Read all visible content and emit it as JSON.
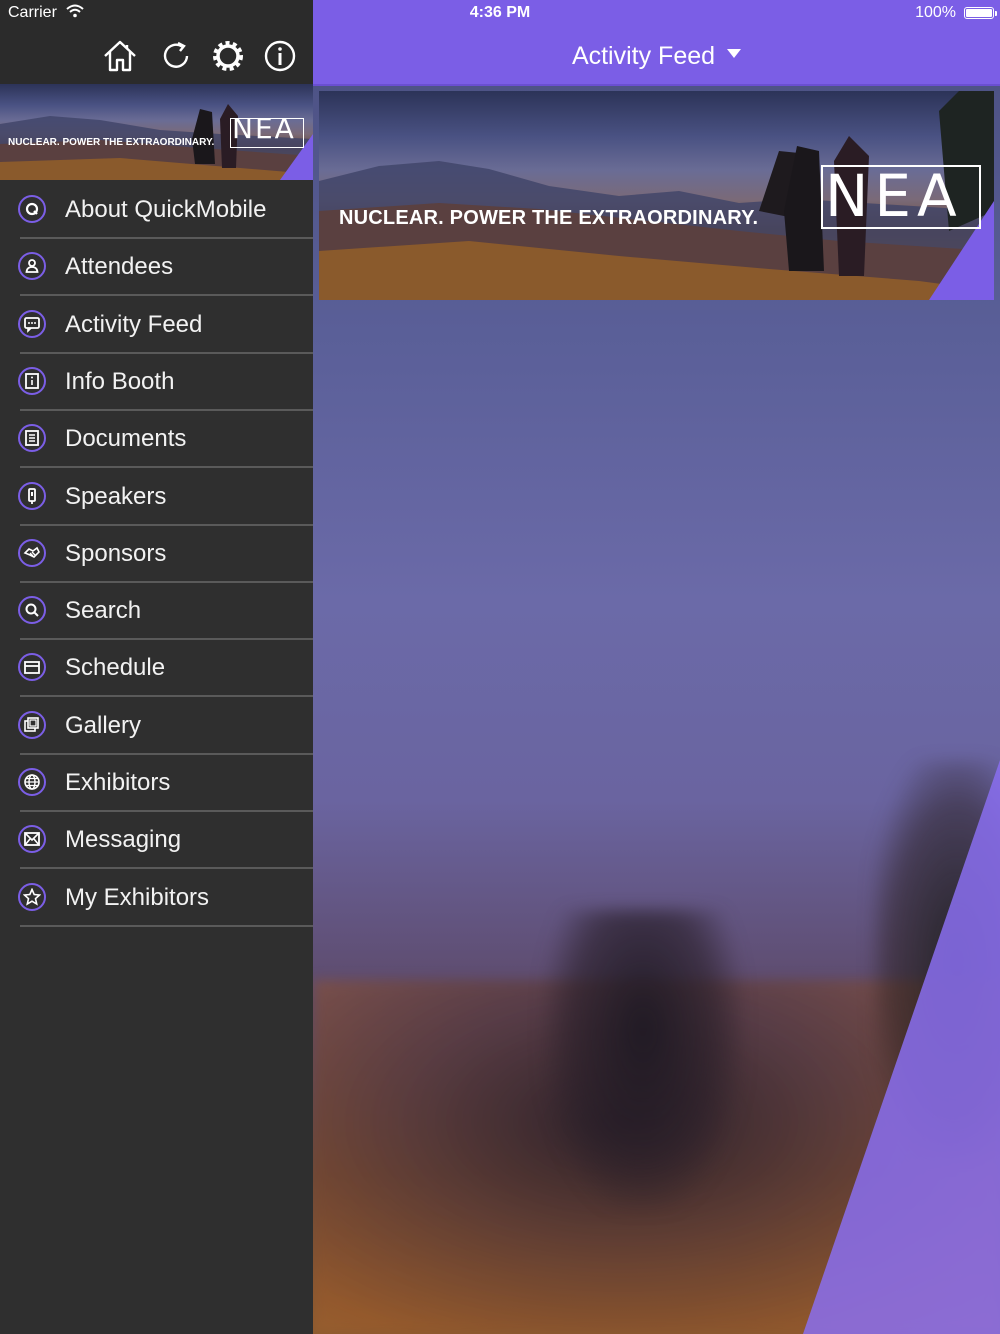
{
  "status_bar": {
    "carrier": "Carrier",
    "time": "4:36 PM",
    "battery": "100%"
  },
  "top_bar": {
    "title": "Activity Feed"
  },
  "banner": {
    "tagline": "NUCLEAR. POWER THE EXTRAORDINARY.",
    "logo": "NEA"
  },
  "toolbar": {
    "icons": [
      "home-icon",
      "refresh-icon",
      "settings-icon",
      "info-icon"
    ]
  },
  "sidebar": {
    "items": [
      {
        "label": "About QuickMobile",
        "icon": "quickmobile-icon"
      },
      {
        "label": "Attendees",
        "icon": "person-icon"
      },
      {
        "label": "Activity Feed",
        "icon": "chat-icon"
      },
      {
        "label": "Info Booth",
        "icon": "info-booth-icon"
      },
      {
        "label": "Documents",
        "icon": "document-icon"
      },
      {
        "label": "Speakers",
        "icon": "microphone-icon"
      },
      {
        "label": "Sponsors",
        "icon": "handshake-icon"
      },
      {
        "label": "Search",
        "icon": "search-icon"
      },
      {
        "label": "Schedule",
        "icon": "calendar-icon"
      },
      {
        "label": "Gallery",
        "icon": "gallery-icon"
      },
      {
        "label": "Exhibitors",
        "icon": "globe-icon"
      },
      {
        "label": "Messaging",
        "icon": "envelope-icon"
      },
      {
        "label": "My Exhibitors",
        "icon": "star-icon"
      }
    ]
  },
  "colors": {
    "accent": "#7b5ee6",
    "sidebar_bg": "#2f2f2f",
    "divider": "#5a5a5a"
  }
}
